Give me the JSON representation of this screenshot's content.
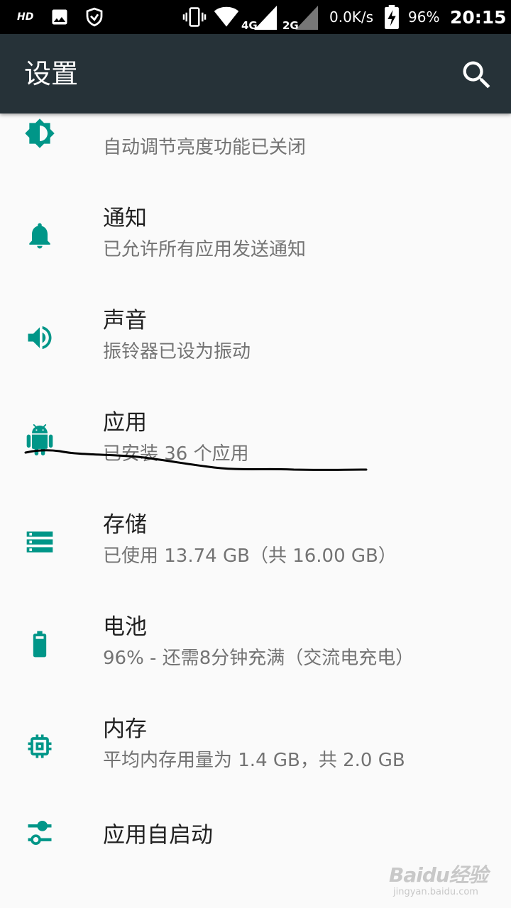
{
  "status_bar": {
    "hd": "HD",
    "net_speed": "0.0K/s",
    "battery": "96%",
    "time": "20:15",
    "sig1_label": "4G",
    "sig2_label": "2G"
  },
  "toolbar": {
    "title": "设置"
  },
  "settings": [
    {
      "title": "",
      "summary": "自动调节亮度功能已关闭"
    },
    {
      "title": "通知",
      "summary": "已允许所有应用发送通知"
    },
    {
      "title": "声音",
      "summary": "振铃器已设为振动"
    },
    {
      "title": "应用",
      "summary": "已安装 36 个应用"
    },
    {
      "title": "存储",
      "summary": "已使用 13.74 GB（共 16.00 GB）"
    },
    {
      "title": "电池",
      "summary": "96% - 还需8分钟充满（交流电充电）"
    },
    {
      "title": "内存",
      "summary": "平均内存用量为 1.4 GB，共 2.0 GB"
    },
    {
      "title": "应用自启动"
    }
  ],
  "watermark": {
    "logo": "Baidu经验",
    "url": "jingyan.baidu.com"
  },
  "colors": {
    "accent": "#009688",
    "toolbar": "#263238",
    "background": "#fafafa"
  }
}
